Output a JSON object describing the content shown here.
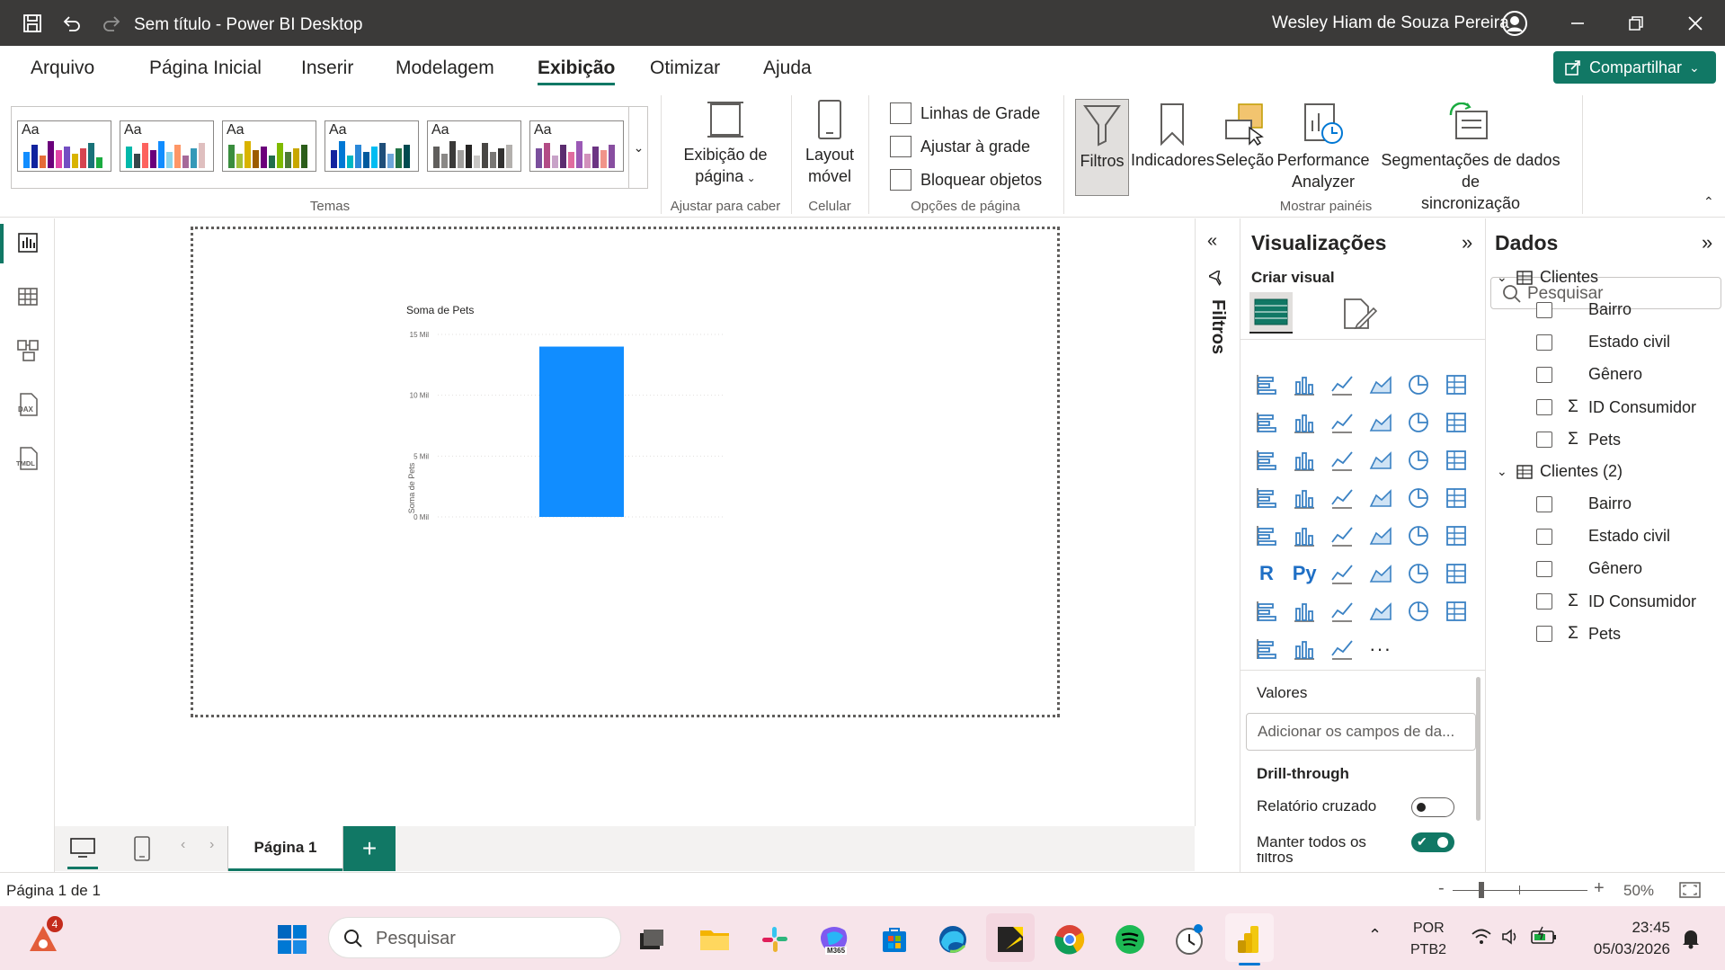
{
  "window": {
    "title": "Sem título - Power BI Desktop",
    "user": "Wesley Hiam de Souza Pereira"
  },
  "menu": {
    "items": [
      "Arquivo",
      "Página Inicial",
      "Inserir",
      "Modelagem",
      "Exibição",
      "Otimizar",
      "Ajuda"
    ],
    "active": "Exibição",
    "share_label": "Compartilhar"
  },
  "ribbon": {
    "themes_label": "Temas",
    "page_view": {
      "line1": "Exibição de",
      "line2": "página"
    },
    "fit_label": "Ajustar para caber",
    "mobile": {
      "line1": "Layout",
      "line2": "móvel"
    },
    "mobile_label": "Celular",
    "checks": [
      "Linhas de Grade",
      "Ajustar à grade",
      "Bloquear objetos"
    ],
    "page_options_label": "Opções de página",
    "panes": {
      "filters": "Filtros",
      "bookmarks": "Indicadores",
      "selection": "Seleção",
      "perf_line1": "Performance",
      "perf_line2": "Analyzer",
      "sync_line1": "Segmentações de dados de",
      "sync_line2": "sincronização"
    },
    "show_panes_label": "Mostrar painéis",
    "theme_aa": "Aa"
  },
  "colors": {
    "accent": "#117865",
    "bar": "#118DFF",
    "titlebar": "#3b3a39"
  },
  "chart_data": {
    "type": "bar",
    "title": "Soma de Pets",
    "ylabel": "Soma de Pets",
    "xlabel": "",
    "categories": [
      ""
    ],
    "values": [
      14
    ],
    "y_tick_labels": [
      "15 Mil",
      "10 Mil",
      "5 Mil",
      "0 Mil"
    ],
    "y_ticks": [
      15,
      10,
      5,
      0
    ],
    "ylim": [
      0,
      15
    ],
    "grid": true
  },
  "filters_pane": {
    "label": "Filtros"
  },
  "viz_pane": {
    "title": "Visualizações",
    "build_visual": "Criar visual",
    "values_label": "Valores",
    "values_placeholder": "Adicionar os campos de da...",
    "drill_label": "Drill-through",
    "cross_report": "Relatório cruzado",
    "keep_filters": "Manter todos os",
    "keep_filters_cont": "filtros"
  },
  "data_pane": {
    "title": "Dados",
    "search_placeholder": "Pesquisar",
    "tables": [
      {
        "name": "Clientes",
        "fields": [
          {
            "name": "Bairro",
            "sigma": false
          },
          {
            "name": "Estado civil",
            "sigma": false
          },
          {
            "name": "Gênero",
            "sigma": false
          },
          {
            "name": "ID Consumidor",
            "sigma": true
          },
          {
            "name": "Pets",
            "sigma": true
          }
        ]
      },
      {
        "name": "Clientes (2)",
        "fields": [
          {
            "name": "Bairro",
            "sigma": false
          },
          {
            "name": "Estado civil",
            "sigma": false
          },
          {
            "name": "Gênero",
            "sigma": false
          },
          {
            "name": "ID Consumidor",
            "sigma": true
          },
          {
            "name": "Pets",
            "sigma": true
          }
        ]
      }
    ]
  },
  "pages": {
    "tab1": "Página 1",
    "add": "+"
  },
  "status": {
    "page_info": "Página 1 de 1",
    "zoom": "50%",
    "zoom_minus": "-",
    "zoom_plus": "+"
  },
  "taskbar": {
    "search_placeholder": "Pesquisar",
    "lang1": "POR",
    "lang2": "PTB2",
    "time": "23:45",
    "date": "05/03/2026",
    "notif_count": "4",
    "m365_label": "M365"
  }
}
